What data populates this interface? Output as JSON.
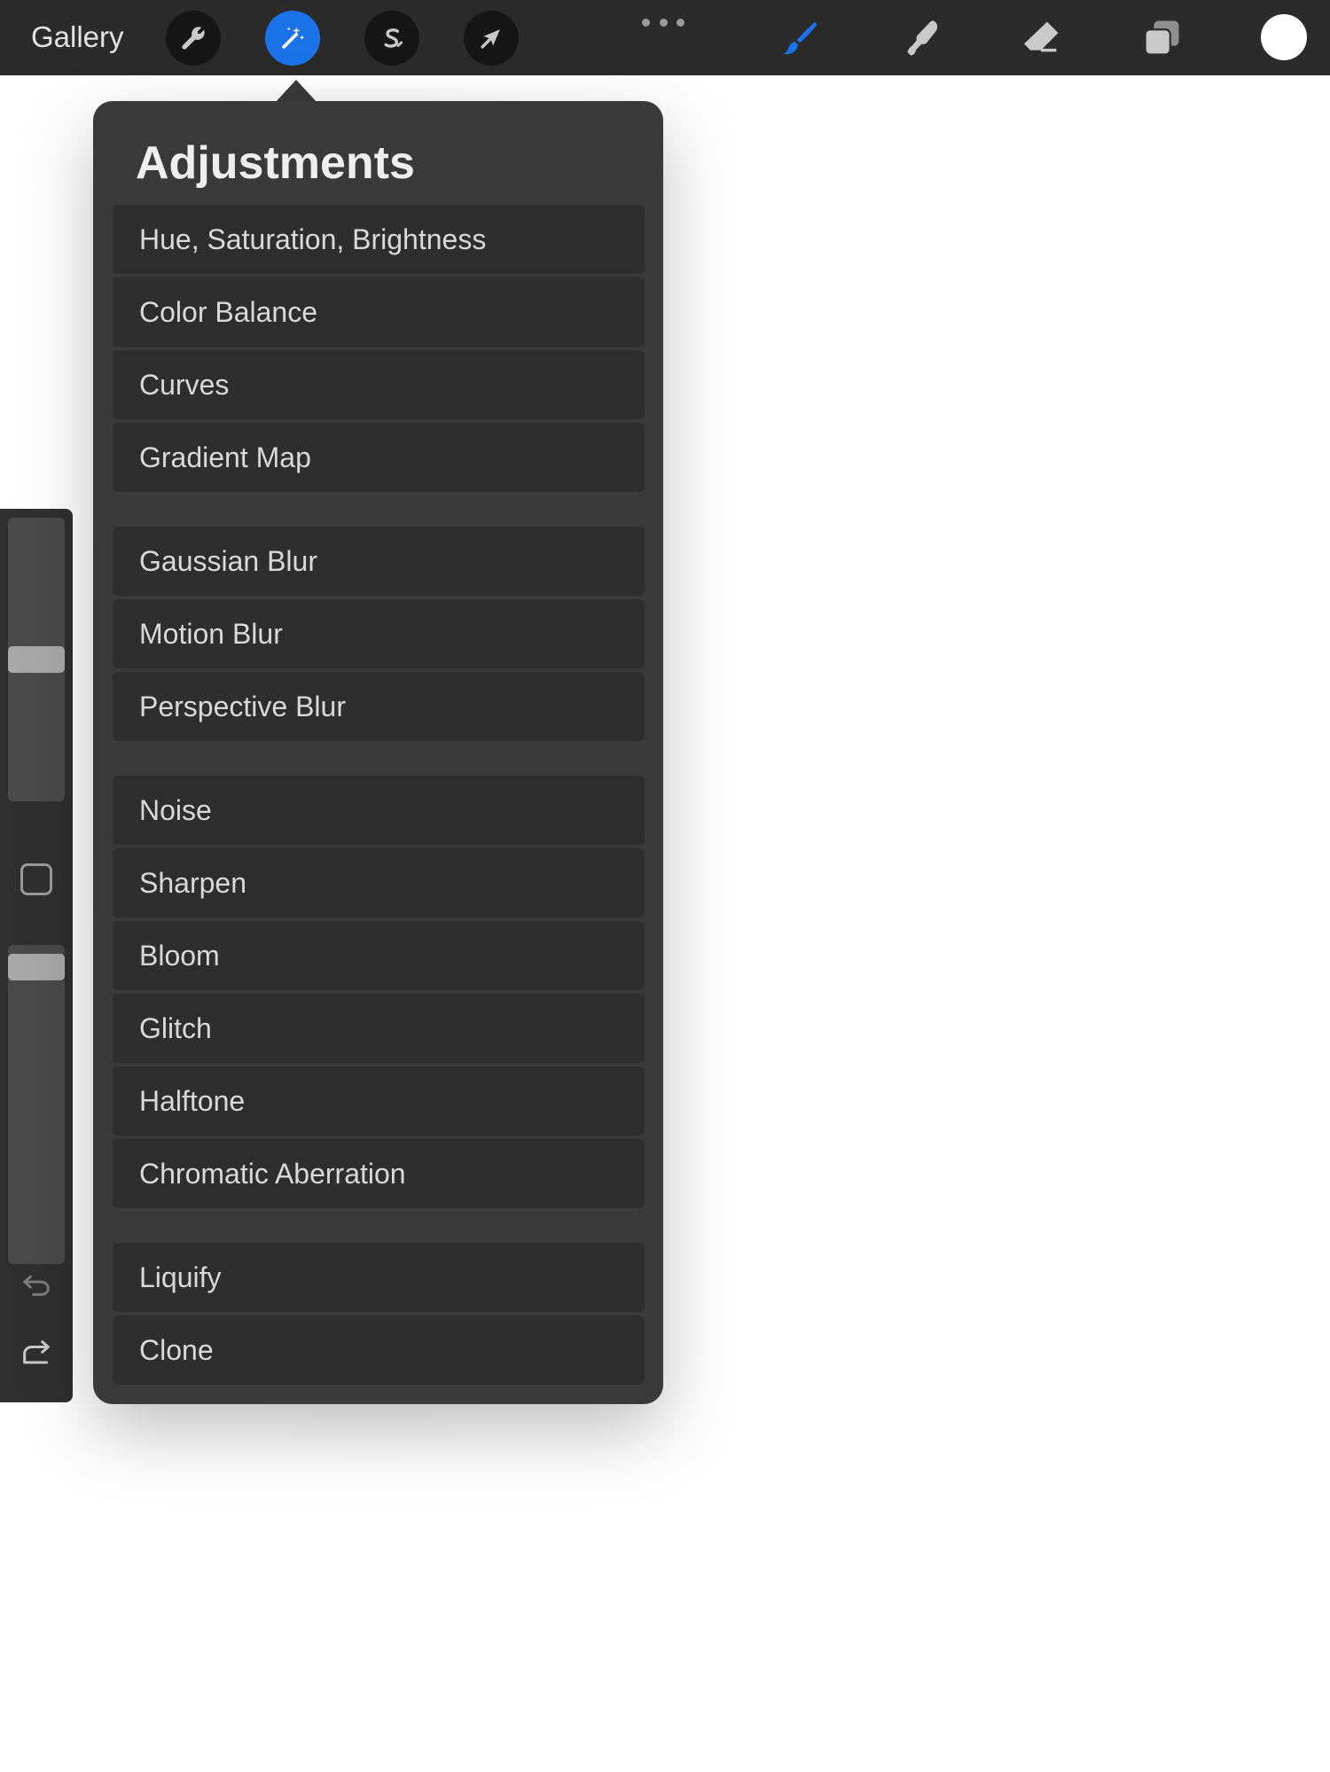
{
  "app": {
    "gallery_label": "Gallery"
  },
  "toolbar": {
    "left_tools": [
      {
        "name": "wrench-icon"
      },
      {
        "name": "magic-wand-icon",
        "active": true
      },
      {
        "name": "selection-s-icon"
      },
      {
        "name": "arrow-cursor-icon"
      }
    ],
    "right_tools": [
      {
        "name": "brush-icon",
        "active": true
      },
      {
        "name": "smudge-icon"
      },
      {
        "name": "eraser-icon"
      },
      {
        "name": "layers-icon"
      }
    ],
    "active_color": "#ffffff",
    "accent_color": "#1a73e8"
  },
  "adjustments": {
    "title": "Adjustments",
    "groups": [
      [
        "Hue, Saturation, Brightness",
        "Color Balance",
        "Curves",
        "Gradient Map"
      ],
      [
        "Gaussian Blur",
        "Motion Blur",
        "Perspective Blur"
      ],
      [
        "Noise",
        "Sharpen",
        "Bloom",
        "Glitch",
        "Halftone",
        "Chromatic Aberration"
      ],
      [
        "Liquify",
        "Clone"
      ]
    ]
  },
  "sidebar": {
    "brush_size_level": 0.5,
    "opacity_level": 0.97
  }
}
